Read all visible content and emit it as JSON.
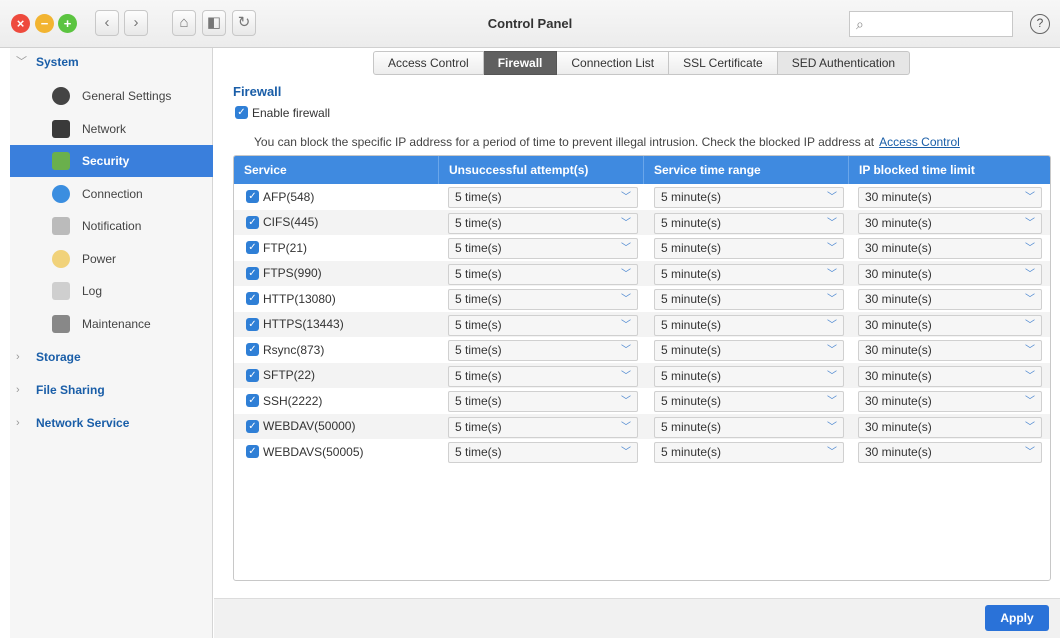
{
  "window": {
    "title": "Control Panel"
  },
  "header": {
    "search_placeholder": "",
    "help_glyph": "?"
  },
  "sidebar": {
    "sections": [
      {
        "label": "System",
        "expanded": true,
        "items": [
          {
            "label": "General Settings",
            "icon": "general-settings-icon",
            "color": "#444444"
          },
          {
            "label": "Network",
            "icon": "network-icon",
            "color": "#3a3a3a"
          },
          {
            "label": "Security",
            "icon": "lock-icon",
            "color": "#6ab04c",
            "active": true
          },
          {
            "label": "Connection",
            "icon": "globe-icon",
            "color": "#3b8ee0"
          },
          {
            "label": "Notification",
            "icon": "notification-icon",
            "color": "#bbbbbb"
          },
          {
            "label": "Power",
            "icon": "bulb-icon",
            "color": "#f1d27a"
          },
          {
            "label": "Log",
            "icon": "log-icon",
            "color": "#cfcfcf"
          },
          {
            "label": "Maintenance",
            "icon": "tools-icon",
            "color": "#888888"
          }
        ]
      },
      {
        "label": "Storage",
        "expanded": false
      },
      {
        "label": "File Sharing",
        "expanded": false
      },
      {
        "label": "Network Service",
        "expanded": false
      }
    ]
  },
  "tabs": [
    {
      "label": "Access Control",
      "active": false
    },
    {
      "label": "Firewall",
      "active": true
    },
    {
      "label": "Connection List",
      "active": false
    },
    {
      "label": "SSL Certificate",
      "active": false
    },
    {
      "label": "SED Authentication",
      "active": false
    }
  ],
  "firewall": {
    "title": "Firewall",
    "enable_label": "Enable firewall",
    "enabled": true,
    "info_text": "You can block the specific IP address for a period of time to prevent illegal intrusion. Check the blocked IP address at",
    "info_link": "Access Control"
  },
  "table": {
    "headers": [
      "Service",
      "Unsuccessful attempt(s)",
      "Service time range",
      "IP blocked time limit"
    ],
    "rows": [
      {
        "service": "AFP(548)",
        "attempts": "5 time(s)",
        "range": "5 minute(s)",
        "limit": "30 minute(s)"
      },
      {
        "service": "CIFS(445)",
        "attempts": "5 time(s)",
        "range": "5 minute(s)",
        "limit": "30 minute(s)"
      },
      {
        "service": "FTP(21)",
        "attempts": "5 time(s)",
        "range": "5 minute(s)",
        "limit": "30 minute(s)"
      },
      {
        "service": "FTPS(990)",
        "attempts": "5 time(s)",
        "range": "5 minute(s)",
        "limit": "30 minute(s)"
      },
      {
        "service": "HTTP(13080)",
        "attempts": "5 time(s)",
        "range": "5 minute(s)",
        "limit": "30 minute(s)"
      },
      {
        "service": "HTTPS(13443)",
        "attempts": "5 time(s)",
        "range": "5 minute(s)",
        "limit": "30 minute(s)"
      },
      {
        "service": "Rsync(873)",
        "attempts": "5 time(s)",
        "range": "5 minute(s)",
        "limit": "30 minute(s)"
      },
      {
        "service": "SFTP(22)",
        "attempts": "5 time(s)",
        "range": "5 minute(s)",
        "limit": "30 minute(s)"
      },
      {
        "service": "SSH(2222)",
        "attempts": "5 time(s)",
        "range": "5 minute(s)",
        "limit": "30 minute(s)"
      },
      {
        "service": "WEBDAV(50000)",
        "attempts": "5 time(s)",
        "range": "5 minute(s)",
        "limit": "30 minute(s)"
      },
      {
        "service": "WEBDAVS(50005)",
        "attempts": "5 time(s)",
        "range": "5 minute(s)",
        "limit": "30 minute(s)"
      }
    ]
  },
  "footer": {
    "apply_label": "Apply"
  },
  "colors": {
    "accent": "#3f8ae0",
    "active_item": "#3a7fdc",
    "link": "#1a5ea8"
  }
}
